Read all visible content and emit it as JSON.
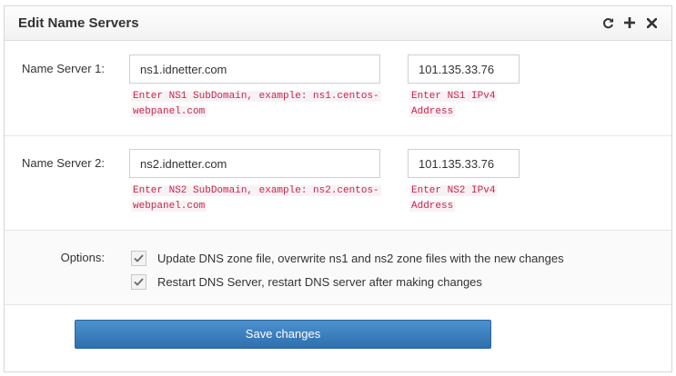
{
  "panel": {
    "title": "Edit Name Servers",
    "icons": [
      "refresh-icon",
      "expand-plus-icon",
      "close-icon"
    ]
  },
  "ns1": {
    "label": "Name Server 1:",
    "domain_value": "ns1.idnetter.com",
    "domain_help_line1": "Enter NS1 SubDomain, example: ns1.centos-",
    "domain_help_line2": "webpanel.com",
    "ip_value": "101.135.33.76",
    "ip_help_line1": "Enter NS1 IPv4",
    "ip_help_line2": "Address"
  },
  "ns2": {
    "label": "Name Server 2:",
    "domain_value": "ns2.idnetter.com",
    "domain_help_line1": "Enter NS2 SubDomain, example: ns2.centos-",
    "domain_help_line2": "webpanel.com",
    "ip_value": "101.135.33.76",
    "ip_help_line1": "Enter NS2 IPv4",
    "ip_help_line2": "Address"
  },
  "options": {
    "label": "Options:",
    "items": [
      {
        "label": "Update DNS zone file, overwrite ns1 and ns2 zone files with the new changes",
        "checked": true
      },
      {
        "label": "Restart DNS Server, restart DNS server after making changes",
        "checked": true
      }
    ]
  },
  "save_label": "Save changes",
  "colors": {
    "help_text": "#c7254e",
    "help_bg": "#f9f2f4",
    "button_top": "#4c91cf",
    "button_bottom": "#2f6fae"
  }
}
